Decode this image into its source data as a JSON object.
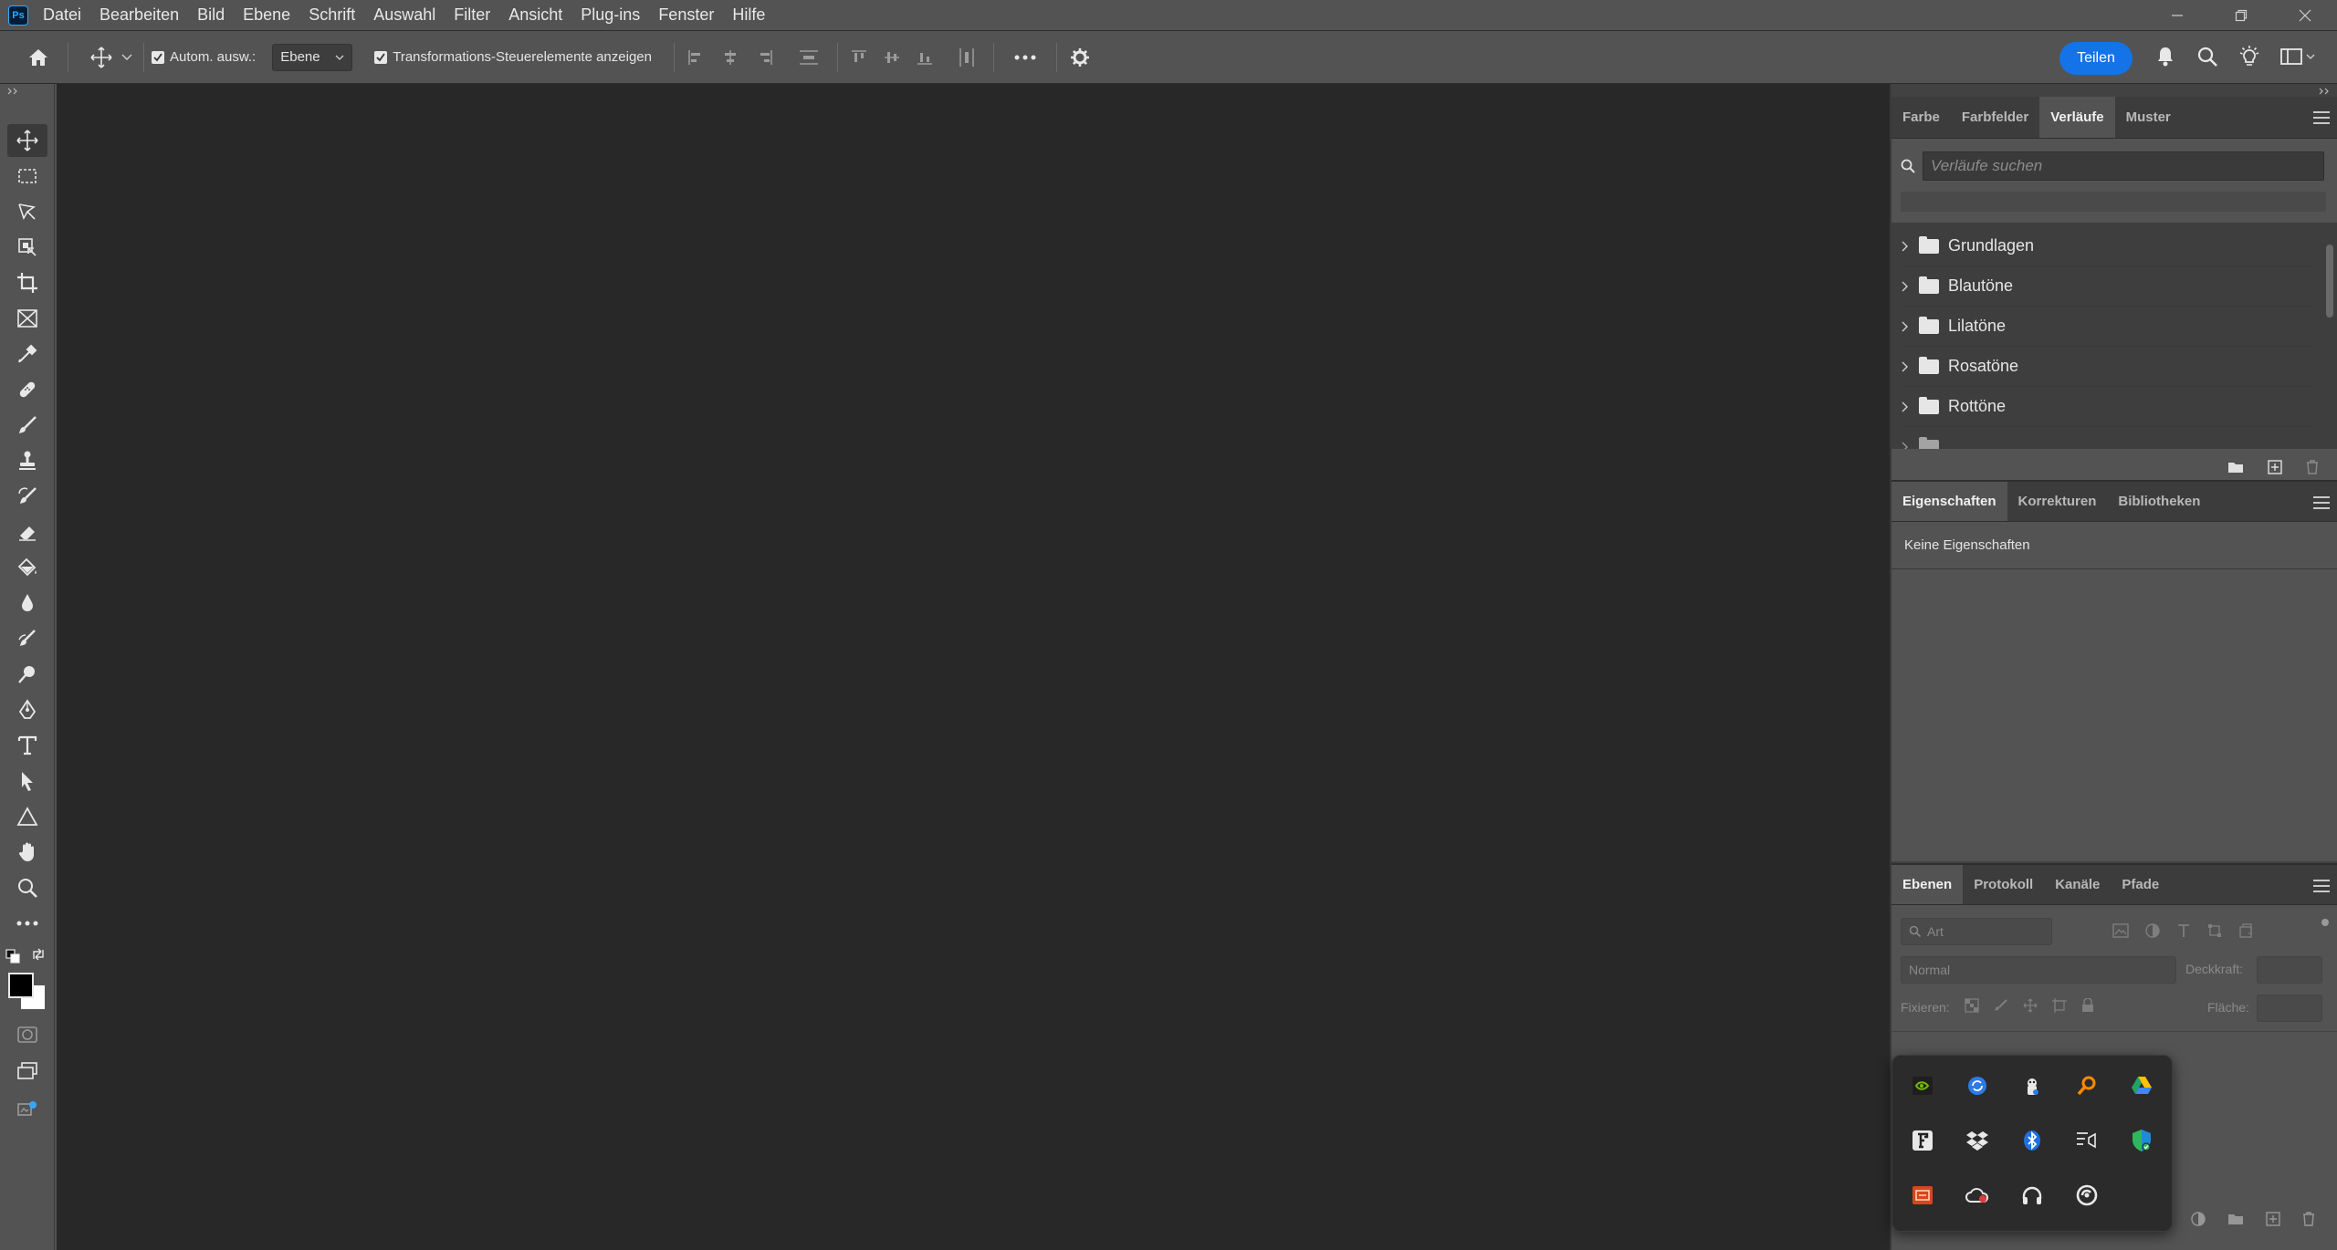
{
  "app": {
    "logo_text": "Ps"
  },
  "menu": [
    "Datei",
    "Bearbeiten",
    "Bild",
    "Ebene",
    "Schrift",
    "Auswahl",
    "Filter",
    "Ansicht",
    "Plug-ins",
    "Fenster",
    "Hilfe"
  ],
  "options_bar": {
    "auto_select_label": "Autom. ausw.:",
    "auto_select_checked": true,
    "auto_select_target": "Ebene",
    "transform_controls_label": "Transformations-Steuerelemente anzeigen",
    "transform_controls_checked": true,
    "share_label": "Teilen"
  },
  "tools": [
    "move-tool-icon",
    "marquee-tool-icon",
    "lasso-tool-icon",
    "object-select-tool-icon",
    "crop-tool-icon",
    "frame-tool-icon",
    "eyedropper-tool-icon",
    "healing-brush-tool-icon",
    "brush-tool-icon",
    "clone-stamp-tool-icon",
    "history-brush-tool-icon",
    "eraser-tool-icon",
    "paint-bucket-tool-icon",
    "blur-tool-icon",
    "smudge-tool-icon",
    "dodge-tool-icon",
    "pen-tool-icon",
    "type-tool-icon",
    "path-select-tool-icon",
    "shape-tool-icon",
    "hand-tool-icon",
    "zoom-tool-icon",
    "more-tools-icon"
  ],
  "colors": {
    "foreground": "#000000",
    "background": "#ffffff",
    "accent": "#1473e6"
  },
  "gradients_panel": {
    "tabs": [
      "Farbe",
      "Farbfelder",
      "Verläufe",
      "Muster"
    ],
    "active_tab": "Verläufe",
    "search_placeholder": "Verläufe suchen",
    "groups": [
      "Grundlagen",
      "Blautöne",
      "Lilatöne",
      "Rosatöne",
      "Rottöne"
    ]
  },
  "properties_panel": {
    "tabs": [
      "Eigenschaften",
      "Korrekturen",
      "Bibliotheken"
    ],
    "active_tab": "Eigenschaften",
    "empty_text": "Keine Eigenschaften"
  },
  "layers_panel": {
    "tabs": [
      "Ebenen",
      "Protokoll",
      "Kanäle",
      "Pfade"
    ],
    "active_tab": "Ebenen",
    "filter_placeholder": "Art",
    "blend_mode": "Normal",
    "opacity_label": "Deckkraft:",
    "lock_label": "Fixieren:",
    "fill_label": "Fläche:"
  },
  "tray_icons": [
    "nvidia-icon",
    "sync-icon",
    "steam-icon",
    "search-app-icon",
    "google-drive-icon",
    "font-app-icon",
    "dropbox-icon",
    "bluetooth-icon",
    "media-icon",
    "security-shield-icon",
    "cpu-monitor-icon",
    "cloud-app-icon",
    "headphones-icon",
    "arc-app-icon"
  ]
}
